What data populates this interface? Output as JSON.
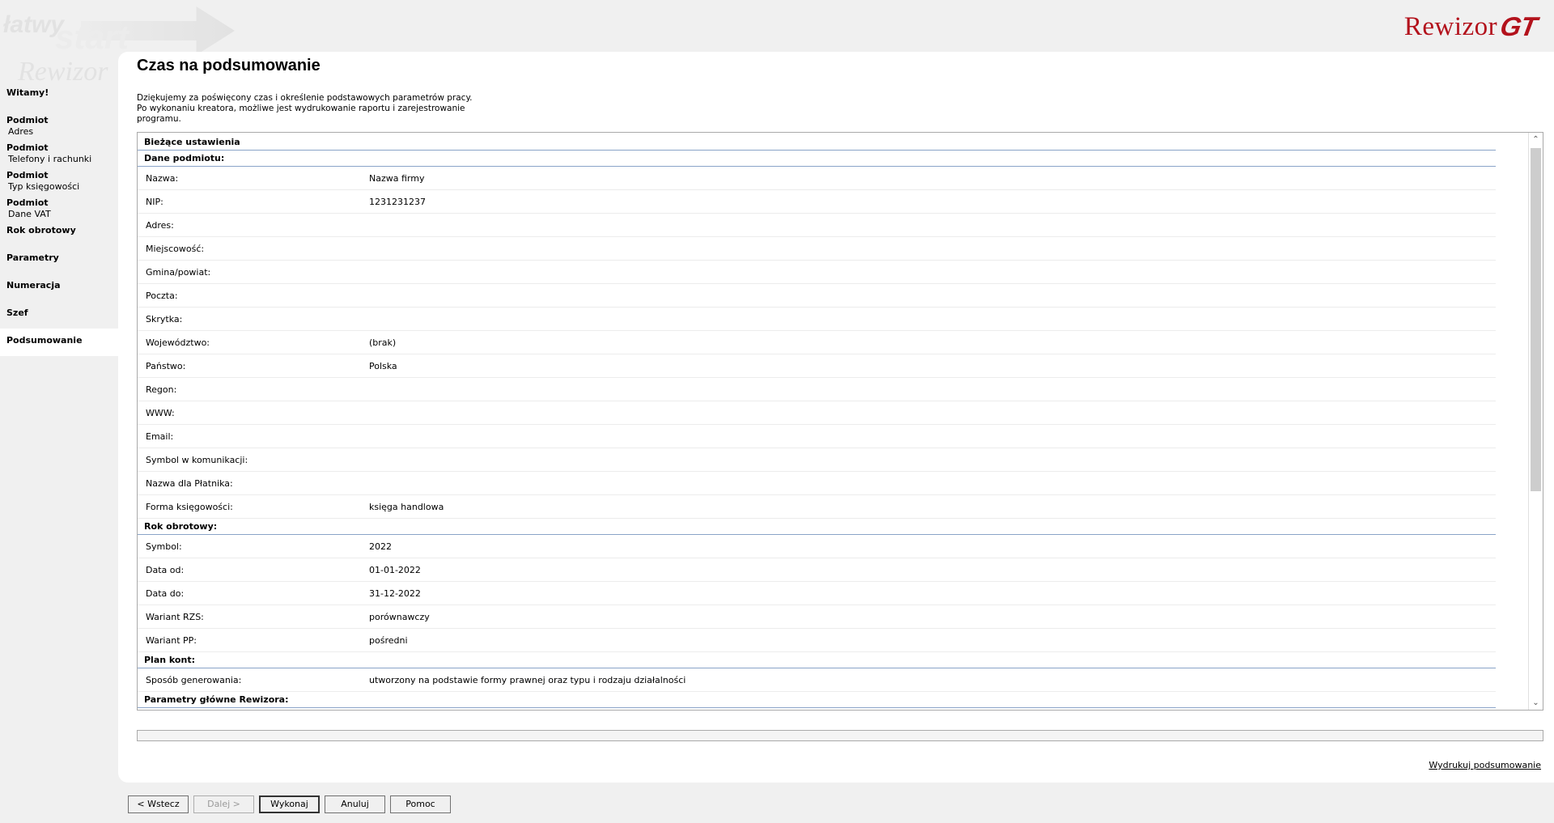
{
  "watermark": {
    "w1": "łatwy",
    "w2": "start",
    "w3": "Rewizor"
  },
  "logo": {
    "word": "Rewizor",
    "gt": "GT"
  },
  "sidebar": {
    "items": [
      {
        "title": "Witamy!",
        "sub": ""
      },
      {
        "title": "Podmiot",
        "sub": "Adres"
      },
      {
        "title": "Podmiot",
        "sub": "Telefony i rachunki"
      },
      {
        "title": "Podmiot",
        "sub": "Typ księgowości"
      },
      {
        "title": "Podmiot",
        "sub": "Dane VAT"
      },
      {
        "title": "Rok obrotowy",
        "sub": ""
      },
      {
        "title": "Parametry",
        "sub": ""
      },
      {
        "title": "Numeracja",
        "sub": ""
      },
      {
        "title": "Szef",
        "sub": ""
      },
      {
        "title": "Podsumowanie",
        "sub": ""
      }
    ]
  },
  "main": {
    "title": "Czas na podsumowanie",
    "intro": "Dziękujemy za poświęcony czas i określenie podstawowych parametrów pracy. Po wykonaniu kreatora, możliwe jest wydrukowanie raportu i zarejestrowanie programu."
  },
  "summary": {
    "header": "Bieżące ustawienia",
    "dane_header": "Dane podmiotu:",
    "dane": [
      {
        "label": "Nazwa:",
        "value": "Nazwa firmy"
      },
      {
        "label": "NIP:",
        "value": "1231231237"
      },
      {
        "label": "Adres:",
        "value": ""
      },
      {
        "label": "Miejscowość:",
        "value": ""
      },
      {
        "label": "Gmina/powiat:",
        "value": ""
      },
      {
        "label": "Poczta:",
        "value": ""
      },
      {
        "label": "Skrytka:",
        "value": ""
      },
      {
        "label": "Województwo:",
        "value": "(brak)"
      },
      {
        "label": "Państwo:",
        "value": "Polska"
      },
      {
        "label": "Regon:",
        "value": ""
      },
      {
        "label": "WWW:",
        "value": ""
      },
      {
        "label": "Email:",
        "value": ""
      },
      {
        "label": "Symbol w komunikacji:",
        "value": ""
      },
      {
        "label": "Nazwa dla Płatnika:",
        "value": ""
      },
      {
        "label": "Forma księgowości:",
        "value": "księga handlowa"
      }
    ],
    "rok_header": "Rok obrotowy:",
    "rok": [
      {
        "label": "Symbol:",
        "value": "2022"
      },
      {
        "label": "Data od:",
        "value": "01-01-2022"
      },
      {
        "label": "Data do:",
        "value": "31-12-2022"
      },
      {
        "label": "Wariant RZS:",
        "value": "porównawczy"
      },
      {
        "label": "Wariant PP:",
        "value": "pośredni"
      }
    ],
    "plan_header": "Plan kont:",
    "plan": [
      {
        "label": "Sposób generowania:",
        "value": "utworzony na podstawie formy prawnej oraz typu i rodzaju działalności"
      }
    ],
    "param_header": "Parametry główne Rewizora:"
  },
  "print_link": "Wydrukuj podsumowanie",
  "buttons": {
    "back": "< Wstecz",
    "next": "Dalej >",
    "execute": "Wykonaj",
    "cancel": "Anuluj",
    "help": "Pomoc"
  }
}
